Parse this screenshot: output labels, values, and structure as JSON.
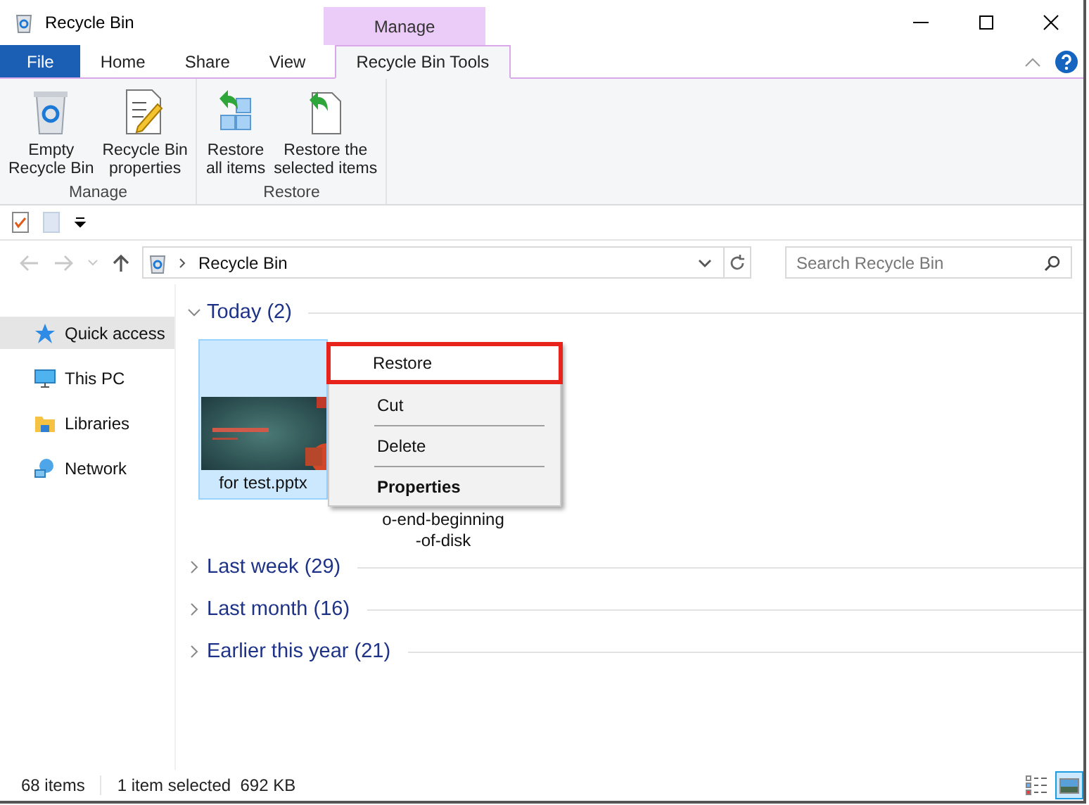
{
  "window": {
    "title": "Recycle Bin"
  },
  "ribbon": {
    "contextual_label": "Manage",
    "tabs": [
      {
        "label": "File",
        "kind": "file",
        "selected": false
      },
      {
        "label": "Home",
        "kind": "plain",
        "selected": false
      },
      {
        "label": "Share",
        "kind": "plain",
        "selected": false
      },
      {
        "label": "View",
        "kind": "plain",
        "selected": false
      },
      {
        "label": "Recycle Bin Tools",
        "kind": "contextual",
        "selected": true
      }
    ],
    "groups": [
      {
        "label": "Manage",
        "buttons": [
          {
            "lines": [
              "Empty",
              "Recycle Bin"
            ],
            "kind": "bin"
          },
          {
            "lines": [
              "Recycle Bin",
              "properties"
            ],
            "kind": "props"
          }
        ]
      },
      {
        "label": "Restore",
        "buttons": [
          {
            "lines": [
              "Restore",
              "all items"
            ],
            "kind": "restore-all"
          },
          {
            "lines": [
              "Restore the",
              "selected items"
            ],
            "kind": "restore-sel"
          }
        ]
      }
    ]
  },
  "address": {
    "path": "Recycle Bin"
  },
  "search": {
    "placeholder": "Search Recycle Bin"
  },
  "sidebar": {
    "items": [
      {
        "label": "Quick access",
        "kind": "star",
        "selected": true
      },
      {
        "label": "This PC",
        "kind": "pc",
        "selected": false
      },
      {
        "label": "Libraries",
        "kind": "library",
        "selected": false
      },
      {
        "label": "Network",
        "kind": "network",
        "selected": false
      }
    ]
  },
  "groups": [
    {
      "label": "Today (2)",
      "expanded": true,
      "items": [
        {
          "lines": [
            "for test.pptx"
          ],
          "kind": "picture",
          "selected": true
        },
        {
          "lines": [
            "o-end-beginning",
            "-of-disk"
          ],
          "kind": "hidden",
          "selected": false
        }
      ]
    },
    {
      "label": "Last week (29)",
      "expanded": false
    },
    {
      "label": "Last month (16)",
      "expanded": false
    },
    {
      "label": "Earlier this year (21)",
      "expanded": false
    }
  ],
  "context_menu": {
    "items": [
      {
        "label": "Restore",
        "highlighted": true,
        "bold": false,
        "separator_before": false
      },
      {
        "label": "Cut",
        "highlighted": false,
        "bold": false,
        "separator_before": false
      },
      {
        "label": "Delete",
        "highlighted": false,
        "bold": false,
        "separator_before": true
      },
      {
        "label": "Properties",
        "highlighted": false,
        "bold": true,
        "separator_before": true
      }
    ]
  },
  "status_bar": {
    "count": "68 items",
    "selection": "1 item selected  692 KB"
  },
  "views": [
    {
      "kind": "details",
      "selected": false
    },
    {
      "kind": "large-icons",
      "selected": true
    }
  ]
}
